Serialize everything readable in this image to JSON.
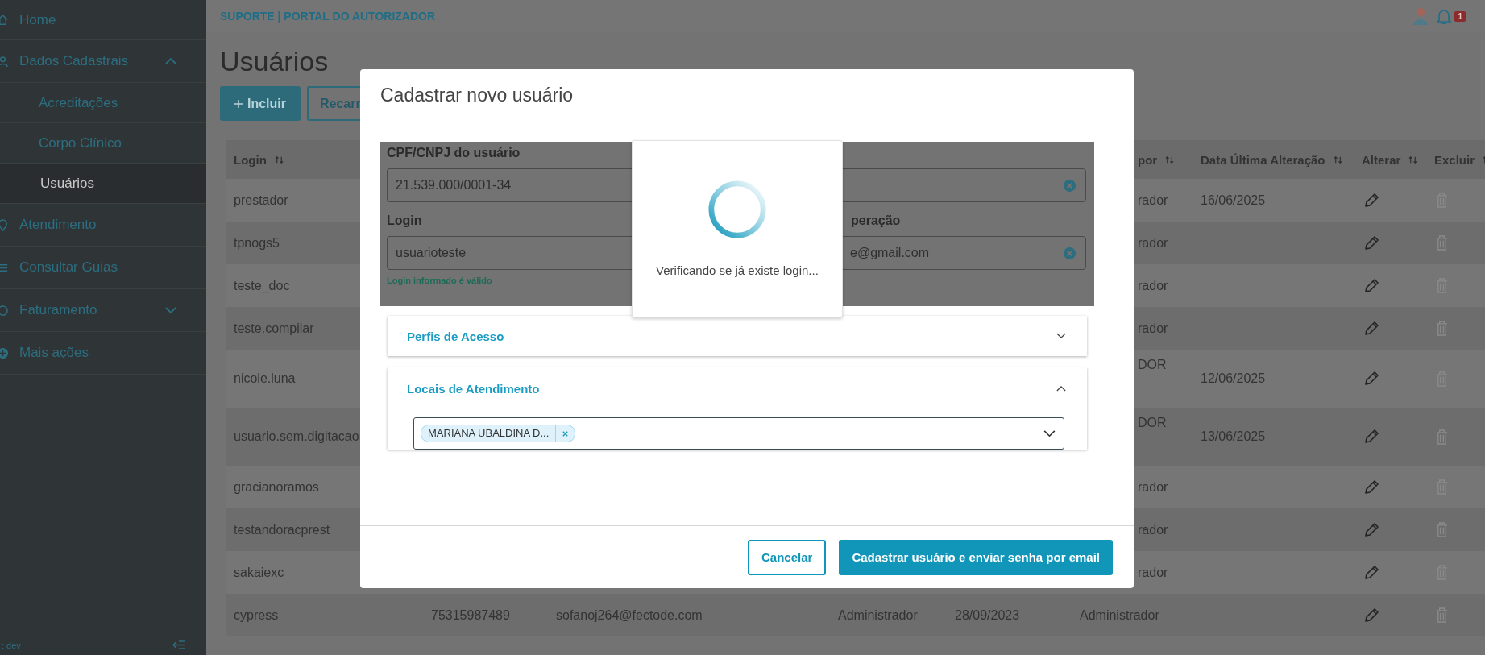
{
  "header": {
    "title": "SUPORTE | PORTAL DO AUTORIZADOR",
    "notifications": "1"
  },
  "sidebar": {
    "items": [
      {
        "label": "Home",
        "kind": "home",
        "selected": false
      },
      {
        "label": "Dados Cadastrais",
        "kind": "user",
        "selected": false,
        "expanded": true,
        "children": [
          {
            "label": "Acreditações",
            "selected": false
          },
          {
            "label": "Corpo Clínico",
            "selected": false
          },
          {
            "label": "Usuários",
            "selected": true
          }
        ]
      },
      {
        "label": "Atendimento",
        "kind": "pin",
        "selected": false
      },
      {
        "label": "Consultar Guias",
        "kind": "list",
        "selected": false
      },
      {
        "label": "Faturamento",
        "kind": "coin",
        "selected": false,
        "expanded": false
      },
      {
        "label": "Mais ações",
        "kind": "plus",
        "selected": false
      }
    ],
    "footer": ": dev"
  },
  "page": {
    "title": "Usuários",
    "buttons": [
      {
        "label": "Incluir",
        "kind": "primary"
      },
      {
        "label": "Recarr",
        "kind": "outline"
      }
    ]
  },
  "table": {
    "columns": {
      "login": "Login",
      "column_6": "por",
      "date": "Data Última Alteração",
      "edit": "Alterar",
      "delete": "Excluir"
    },
    "rows": [
      {
        "login": "prestador",
        "column_6": "rador",
        "date": "16/06/2025",
        "tall": false,
        "can_delete": false
      },
      {
        "login": "tpnogs5",
        "column_6": "rador",
        "tall": false,
        "can_delete": false
      },
      {
        "login": "teste_doc",
        "column_6": "rador",
        "tall": false,
        "can_delete": false
      },
      {
        "login": "teste.compilar",
        "column_6": "rador",
        "tall": false,
        "can_delete": false
      },
      {
        "login": "nicole.luna",
        "column_6": "DOR",
        "date": "12/06/2025",
        "tall": true,
        "can_delete": false
      },
      {
        "login": "usuario.sem.digitacao",
        "column_6": "DOR",
        "date": "13/06/2025",
        "tall": true,
        "can_delete": false
      },
      {
        "login": "gracianoramos",
        "column_6": "rador",
        "tall": false,
        "can_delete": false
      },
      {
        "login": "testandoracprest",
        "column_6": "rador",
        "tall": false,
        "can_delete": false
      },
      {
        "login": "sakaiexc",
        "column_6": "rador",
        "tall": false,
        "can_delete": false
      },
      {
        "login": "cypress",
        "column_2": "75315987489",
        "column_3": "sofanoj264@fectode.com",
        "column_4": "Administrador",
        "column_5": "28/09/2023",
        "column_6": "Administrador",
        "tall": false,
        "can_delete": false
      }
    ]
  },
  "modal": {
    "title": "Cadastrar novo usuário",
    "form": {
      "left": [
        {
          "label": "CPF/CNPJ do usuário",
          "value": "21.539.000/0001-34"
        },
        {
          "label": "Login",
          "value": "usuarioteste",
          "hint": "Login informado é válido"
        }
      ],
      "right": [
        {
          "clearable": true
        },
        {
          "label": "peração",
          "value": "e@gmail.com",
          "clearable": true
        }
      ]
    },
    "loading": {
      "message": "Verificando se já existe login..."
    },
    "sections": [
      {
        "title": "Perfis de Acesso",
        "expanded": false
      },
      {
        "title": "Locais de Atendimento",
        "expanded": true,
        "selected_items": [
          "MARIANA UBALDINA D..."
        ]
      }
    ],
    "buttons": [
      {
        "label": "Cancelar",
        "kind": "secondary"
      },
      {
        "label": "Cadastrar usuário e enviar senha por email",
        "kind": "primary"
      }
    ]
  }
}
